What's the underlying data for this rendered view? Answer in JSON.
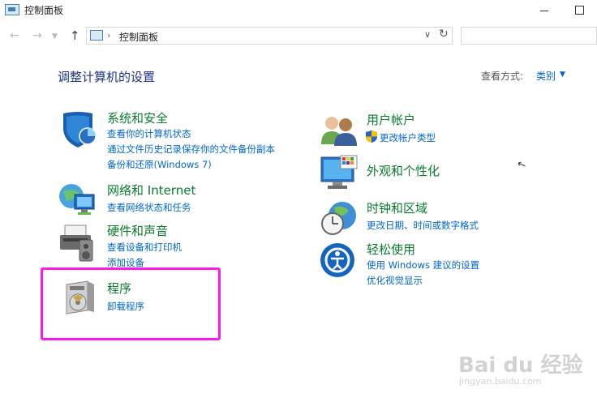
{
  "window": {
    "title": "控制面板"
  },
  "nav": {
    "back_icon": "arrow-left-icon",
    "forward_icon": "arrow-right-icon",
    "recent_icon": "chevron-down-icon",
    "up_icon": "arrow-up-icon",
    "breadcrumb": [
      "控制面板"
    ],
    "search_placeholder": ""
  },
  "header": {
    "title": "调整计算机的设置",
    "view_by_label": "查看方式:",
    "view_by_value": "类别"
  },
  "categories": [
    {
      "title": "系统和安全",
      "icon": "shield-icon",
      "links": [
        "查看你的计算机状态",
        "通过文件历史记录保存你的文件备份副本",
        "备份和还原(Windows 7)"
      ]
    },
    {
      "title": "网络和 Internet",
      "icon": "network-icon",
      "links": [
        "查看网络状态和任务"
      ]
    },
    {
      "title": "硬件和声音",
      "icon": "printer-icon",
      "links": [
        "查看设备和打印机",
        "添加设备"
      ]
    },
    {
      "title": "程序",
      "icon": "programs-icon",
      "links": [
        "卸载程序"
      ]
    },
    {
      "title": "用户帐户",
      "icon": "users-icon",
      "links": [
        "更改帐户类型"
      ]
    },
    {
      "title": "外观和个性化",
      "icon": "monitor-icon",
      "links": []
    },
    {
      "title": "时钟和区域",
      "icon": "clock-globe-icon",
      "links": [
        "更改日期、时间或数字格式"
      ]
    },
    {
      "title": "轻松使用",
      "icon": "ease-of-access-icon",
      "links": [
        "使用 Windows 建议的设置",
        "优化视觉显示"
      ]
    }
  ],
  "watermark": {
    "main": "Bai du 经验",
    "sub": "jingyan.baidu.com"
  },
  "colors": {
    "category_title": "#0b7a2f",
    "link": "#0066cc",
    "page_title": "#1e3287",
    "highlight": "#ff18f0"
  }
}
